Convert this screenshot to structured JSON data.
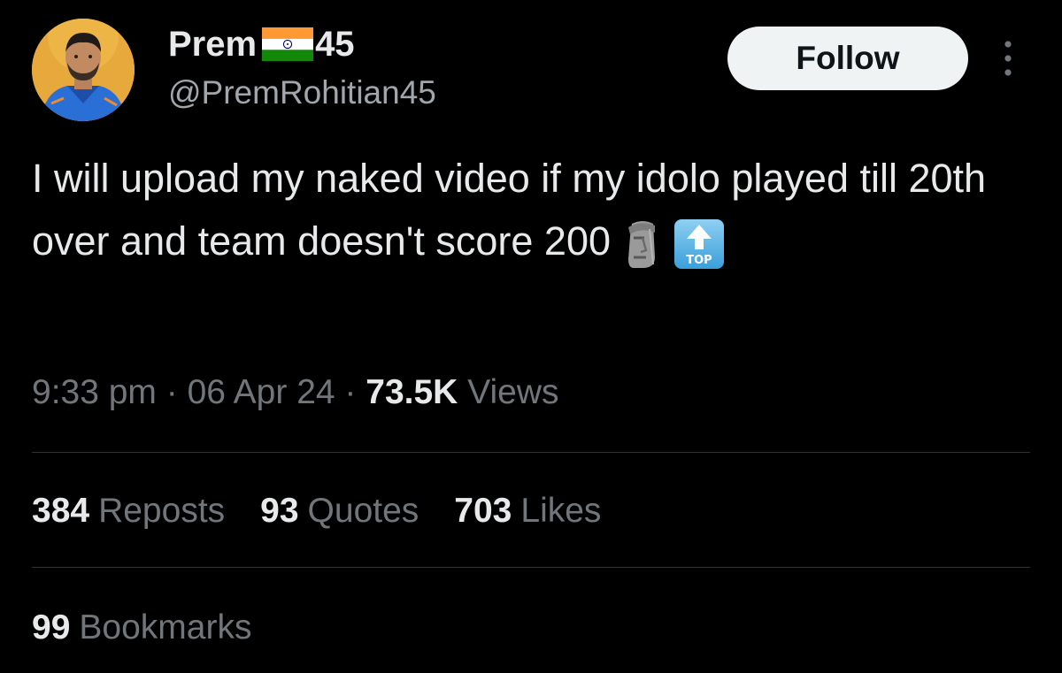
{
  "author": {
    "name_prefix": "Prem",
    "name_suffix": "45",
    "flag_icon": "india-flag-icon",
    "handle": "@PremRohitian45"
  },
  "follow_button": {
    "label": "Follow"
  },
  "tweet": {
    "text": "I will upload my naked video if my idolo played till 20th over and team doesn't score 200",
    "emojis": [
      "moai-icon",
      "top-arrow-icon"
    ],
    "top_emoji_label": "TOP"
  },
  "meta": {
    "time": "9:33 pm",
    "separator": "·",
    "date": "06 Apr 24",
    "views_count": "73.5K",
    "views_label": "Views"
  },
  "stats": {
    "reposts": {
      "count": "384",
      "label": "Reposts"
    },
    "quotes": {
      "count": "93",
      "label": "Quotes"
    },
    "likes": {
      "count": "703",
      "label": "Likes"
    },
    "bookmarks": {
      "count": "99",
      "label": "Bookmarks"
    }
  },
  "colors": {
    "background": "#000000",
    "primary_text": "#e7e9ea",
    "secondary_text": "#71767b",
    "follow_button_bg": "#eff3f4"
  }
}
